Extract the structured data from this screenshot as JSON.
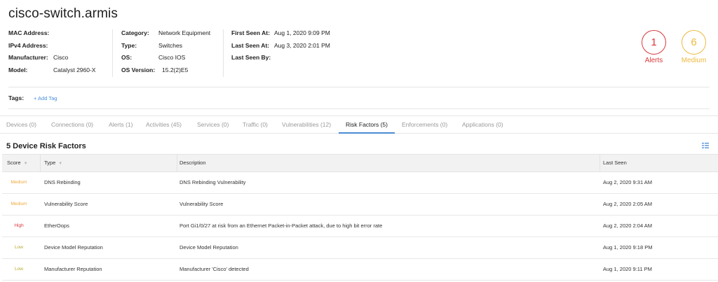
{
  "device": {
    "title": "cisco-switch.armis",
    "col1": [
      {
        "label": "MAC Address:",
        "value": ""
      },
      {
        "label": "IPv4 Address:",
        "value": ""
      },
      {
        "label": "Manufacturer:",
        "value": "Cisco"
      },
      {
        "label": "Model:",
        "value": "Catalyst 2960-X"
      }
    ],
    "col2": [
      {
        "label": "Category:",
        "value": "Network Equipment"
      },
      {
        "label": "Type:",
        "value": "Switches"
      },
      {
        "label": "OS:",
        "value": "Cisco IOS"
      },
      {
        "label": "OS Version:",
        "value": "15.2(2)E5"
      }
    ],
    "col3": [
      {
        "label": "First Seen At:",
        "value": "Aug 1, 2020 9:09 PM"
      },
      {
        "label": "Last Seen At:",
        "value": "Aug 3, 2020 2:01 PM"
      },
      {
        "label": "Last Seen By:",
        "value": ""
      }
    ]
  },
  "badges": {
    "alerts": {
      "count": "1",
      "label": "Alerts",
      "color": "#d9383b"
    },
    "risk": {
      "count": "6",
      "label": "Medium",
      "color": "#efb93f"
    }
  },
  "tags": {
    "label": "Tags:",
    "add_label": "+ Add Tag"
  },
  "tabs": [
    {
      "label": "Devices (0)"
    },
    {
      "label": "Connections (0)"
    },
    {
      "label": "Alerts (1)"
    },
    {
      "label": "Activities (45)"
    },
    {
      "label": "Services (0)"
    },
    {
      "label": "Traffic (0)"
    },
    {
      "label": "Vulnerabilities (12)"
    },
    {
      "label": "Risk Factors (5)"
    },
    {
      "label": "Enforcements (0)"
    },
    {
      "label": "Applications (0)"
    }
  ],
  "active_tab": "Risk Factors (5)",
  "risk_section": {
    "title": "5 Device Risk Factors",
    "columns": {
      "score": "Score",
      "type": "Type",
      "description": "Description",
      "last_seen": "Last Seen"
    },
    "rows": [
      {
        "score": "Medium",
        "type": "DNS Rebinding",
        "description": "DNS Rebinding Vulnerability",
        "last_seen": "Aug 2, 2020 9:31 AM"
      },
      {
        "score": "Medium",
        "type": "Vulnerability Score",
        "description": "Vulnerability Score",
        "last_seen": "Aug 2, 2020 2:05 AM"
      },
      {
        "score": "High",
        "type": "EtherOops",
        "description": "Port Gi1/0/27 at risk from an Ethernet Packet-in-Packet attack, due to high bit error rate",
        "last_seen": "Aug 2, 2020 2:04 AM"
      },
      {
        "score": "Low",
        "type": "Device Model Reputation",
        "description": "Device Model Reputation",
        "last_seen": "Aug 1, 2020 9:18 PM"
      },
      {
        "score": "Low",
        "type": "Manufacturer Reputation",
        "description": "Manufacturer 'Cisco' detected",
        "last_seen": "Aug 1, 2020 9:11 PM"
      }
    ]
  },
  "score_colors": {
    "Medium": "#efa83a",
    "High": "#d9383b",
    "Low": "#b5a92a"
  }
}
